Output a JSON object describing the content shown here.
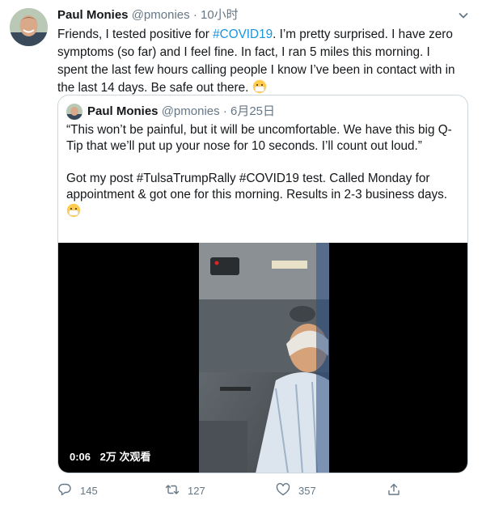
{
  "tweet": {
    "author_name": "Paul Monies",
    "author_handle": "@pmonies",
    "separator": "·",
    "time": "10小时",
    "text_part1": "Friends, I tested positive for ",
    "hashtag": "#COVID19",
    "text_part2": ". I’m pretty surprised. I have zero symptoms (so far) and I feel fine. In fact, I ran 5 miles this morning. I spent the last few hours calling people I know I’ve been in contact with in the last 14 days. Be safe out there. ",
    "emoji_icon": "face-with-medical-mask-icon"
  },
  "quoted": {
    "author_name": "Paul Monies",
    "author_handle": "@pmonies",
    "separator": "·",
    "date": "6月25日",
    "paragraph1": "“This won’t be painful, but it will be uncomfortable. We have this big Q-Tip that we’ll put up your nose for 10 seconds. I’ll count out loud.”",
    "paragraph2": "Got my post #TulsaTrumpRally #COVID19 test. Called Monday for appointment & got one for this morning. Results in 2-3 business days.",
    "video": {
      "duration": "0:06",
      "views": "2万 次观看"
    }
  },
  "actions": {
    "reply_count": "145",
    "retweet_count": "127",
    "like_count": "357"
  },
  "colors": {
    "link": "#1b95e0",
    "secondary_text": "#657786",
    "border": "#ccd6dd"
  }
}
